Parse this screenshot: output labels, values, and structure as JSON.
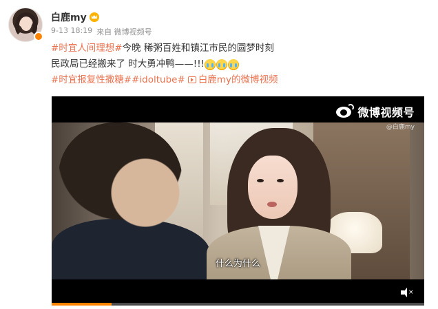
{
  "user": {
    "name": "白鹿my",
    "meta_time": "9-13 18:19",
    "meta_source": "来自 微博视频号"
  },
  "post": {
    "line1_topic": "#时宜人间理想#",
    "line1_text": " 今晚 稀粥百姓和镇江市民的圆梦时刻",
    "line2_text": "民政局已经搬来了 时大勇冲鸭——!!! ",
    "emoji_icons": [
      "crying-emoji-icon",
      "crying-emoji-icon",
      "crying-emoji-icon"
    ],
    "line3_topic1": "#时宜报复性撒糖#",
    "line3_topic2": "#idoltube#",
    "line3_link": "白鹿my的微博视频"
  },
  "video": {
    "watermark": "微博视频号",
    "watermark_sub": "@白鹿my",
    "subtitle": "什么为什么",
    "progress": 0.16
  },
  "colors": {
    "topic": "#eb7350",
    "username": "#333333",
    "meta": "#939393",
    "accent": "#ff8200"
  }
}
